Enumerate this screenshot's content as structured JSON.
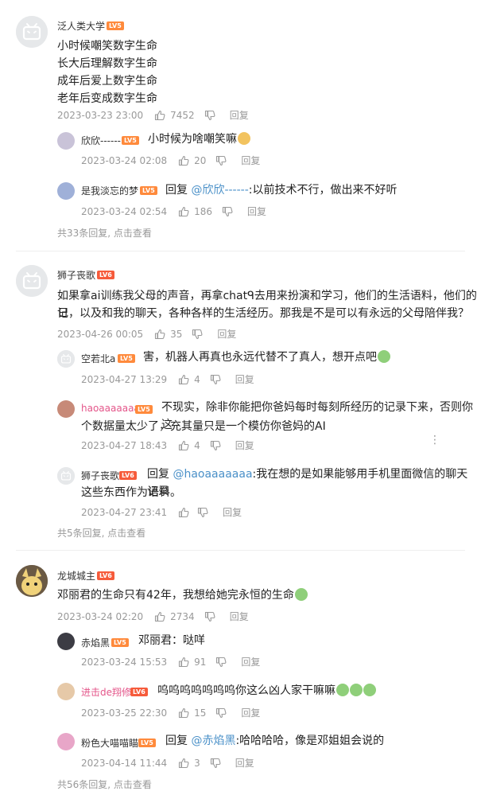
{
  "comments": [
    {
      "user": "泛人类大学",
      "level": "LV5",
      "lines": [
        "小时候嘲笑数字生命",
        "长大后理解数字生命",
        "成年后爱上数字生命",
        "老年后变成数字生命"
      ],
      "time": "2023-03-23 23:00",
      "likes": "7452",
      "reply_label": "回复",
      "replies": [
        {
          "user": "欣欣------",
          "level": "LV5",
          "text": "小时候为啥嘲笑嘛",
          "time": "2023-03-24 02:08",
          "likes": "20",
          "reply_label": "回复"
        },
        {
          "user": "是我淡忘的梦",
          "level": "LV5",
          "reply_prefix": "回复",
          "mention": "@欣欣------",
          "text": ":以前技术不行，做出来不好听",
          "time": "2023-03-24 02:54",
          "likes": "186",
          "reply_label": "回复"
        }
      ],
      "more": "共33条回复, 点击查看"
    },
    {
      "user": "狮子丧歌",
      "level": "LV6",
      "lines": [
        "如果拿ai训练我父母的声音，再拿chatᑫ去用来扮演和学习，他们的生活语料，他们的日",
        "记，以及和我的聊天，各种各样的生活经历。那我是不是可以有永远的父母陪伴我？"
      ],
      "time": "2023-04-26 00:05",
      "likes": "35",
      "reply_label": "回复",
      "replies": [
        {
          "user": "空若北a",
          "level": "LV5",
          "text": "害，机器人再真也永远代替不了真人，想开点吧",
          "time": "2023-04-27 13:29",
          "likes": "4",
          "reply_label": "回复"
        },
        {
          "user": "haoaaaaaaa",
          "level": "LV5",
          "text": "不现实，除非你能把你爸妈每时每刻所经历的记录下来，否则你这",
          "text2": "个数据量太少了，充其量只是一个模仿你爸妈的AI",
          "time": "2023-04-27 18:43",
          "likes": "4",
          "reply_label": "回复"
        },
        {
          "user": "狮子丧歌",
          "level": "LV6",
          "reply_prefix": "回复",
          "mention": "@haoaaaaaaa",
          "text": ":我在想的是如果能够用手机里面微信的聊天记录",
          "text2": "这些东西作为语料。",
          "time": "2023-04-27 23:41",
          "likes": "0",
          "reply_label": "回复"
        }
      ],
      "more": "共5条回复, 点击查看"
    },
    {
      "user": "龙城城主",
      "level": "LV6",
      "lines": [
        "邓丽君的生命只有42年，我想给她完永恒的生命"
      ],
      "time": "2023-03-24 02:20",
      "likes": "2734",
      "reply_label": "回复",
      "replies": [
        {
          "user": "赤焰黑",
          "level": "LV5",
          "text": "邓丽君：哒咩",
          "time": "2023-03-24 15:53",
          "likes": "91",
          "reply_label": "回复"
        },
        {
          "user": "进击de翔修",
          "level": "LV6",
          "text": "呜呜呜呜呜呜呜你这么凶人家干嘛嘛",
          "time": "2023-03-25 22:30",
          "likes": "15",
          "reply_label": "回复"
        },
        {
          "user": "粉色大喵喵瞄",
          "level": "LV5",
          "reply_prefix": "回复",
          "mention": "@赤焰黑",
          "text": ":哈哈哈哈，像是邓姐姐会说的",
          "time": "2023-04-14 11:44",
          "likes": "3",
          "reply_label": "回复"
        }
      ],
      "more": "共56条回复, 点击查看"
    }
  ],
  "colors": {
    "level5": "#ff8a3c",
    "level6": "#f65b3b",
    "link": "#4a90c8",
    "meta": "#999999"
  },
  "icons": {
    "like": "thumb-up-icon",
    "dislike": "thumb-down-icon",
    "more": "more-vertical-icon",
    "avatar_default": "tv-face-icon"
  }
}
